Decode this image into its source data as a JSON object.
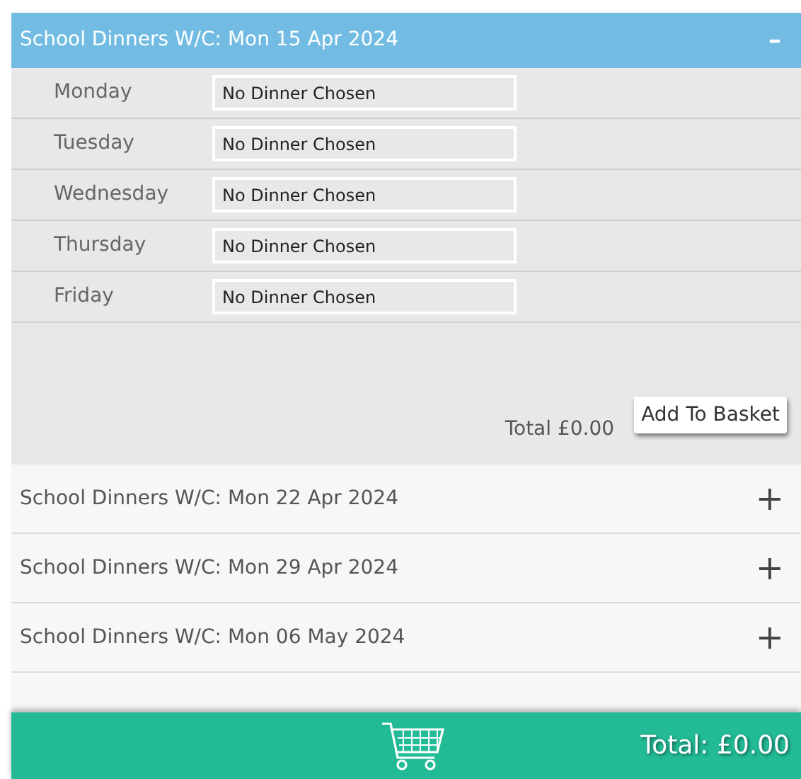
{
  "weeks": [
    {
      "title": "School Dinners W/C: Mon 15 Apr 2024",
      "expanded": true,
      "toggle": "–",
      "days": [
        {
          "day": "Monday",
          "choice": "No Dinner Chosen"
        },
        {
          "day": "Tuesday",
          "choice": "No Dinner Chosen"
        },
        {
          "day": "Wednesday",
          "choice": "No Dinner Chosen"
        },
        {
          "day": "Thursday",
          "choice": "No Dinner Chosen"
        },
        {
          "day": "Friday",
          "choice": "No Dinner Chosen"
        }
      ],
      "total": "Total £0.00",
      "button": "Add To Basket"
    },
    {
      "title": "School Dinners W/C: Mon 22 Apr 2024",
      "expanded": false,
      "toggle": "+"
    },
    {
      "title": "School Dinners W/C: Mon 29 Apr 2024",
      "expanded": false,
      "toggle": "+"
    },
    {
      "title": "School Dinners W/C: Mon 06 May 2024",
      "expanded": false,
      "toggle": "+"
    }
  ],
  "footer": {
    "total": "Total: £0.00"
  }
}
